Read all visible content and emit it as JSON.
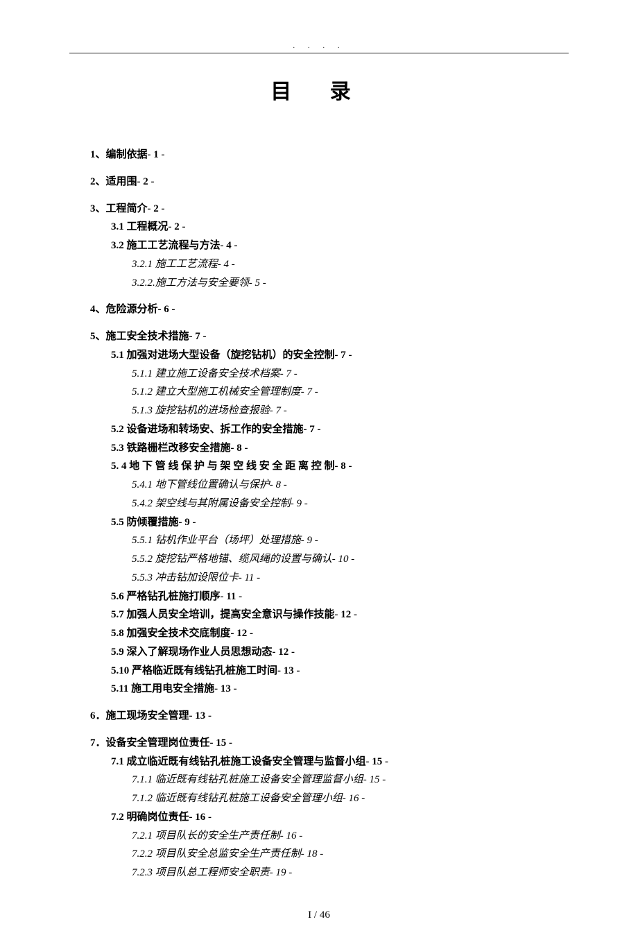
{
  "title": "目  录",
  "footer": "I / 46",
  "toc": [
    {
      "level": 1,
      "text": "1、编制依据- 1 -"
    },
    {
      "level": 1,
      "text": "2、适用围- 2 -"
    },
    {
      "level": 1,
      "text": "3、工程简介- 2 -"
    },
    {
      "level": 2,
      "text": "3.1 工程概况- 2 -"
    },
    {
      "level": 2,
      "text": "3.2 施工工艺流程与方法- 4 -"
    },
    {
      "level": 3,
      "text": "3.2.1 施工工艺流程- 4 -"
    },
    {
      "level": 3,
      "text": "3.2.2.施工方法与安全要领- 5 -"
    },
    {
      "level": 1,
      "text": "4、危险源分析- 6 -"
    },
    {
      "level": 1,
      "text": "5、施工安全技术措施- 7 -"
    },
    {
      "level": 2,
      "text": "5.1 加强对进场大型设备（旋挖钻机）的安全控制- 7 -"
    },
    {
      "level": 3,
      "text": "5.1.1 建立施工设备安全技术档案- 7 -"
    },
    {
      "level": 3,
      "text": "5.1.2 建立大型施工机械安全管理制度- 7 -"
    },
    {
      "level": 3,
      "text": "5.1.3 旋挖钻机的进场检查报验- 7 -"
    },
    {
      "level": 2,
      "text": "5.2 设备进场和转场安、拆工作的安全措施- 7 -"
    },
    {
      "level": 2,
      "text": "5.3 铁路栅栏改移安全措施- 8 -"
    },
    {
      "level": 2,
      "text": "5. 4 地 下 管 线 保 护 与 架 空 线 安 全 距 离 控 制- 8 -"
    },
    {
      "level": 3,
      "text": "5.4.1 地下管线位置确认与保护- 8 -"
    },
    {
      "level": 3,
      "text": "5.4.2 架空线与其附属设备安全控制- 9 -"
    },
    {
      "level": 2,
      "text": "5.5 防倾覆措施- 9 -"
    },
    {
      "level": 3,
      "text": "5.5.1 钻机作业平台（场坪）处理措施- 9 -"
    },
    {
      "level": 3,
      "text": "5.5.2 旋挖钻严格地锚、缆风绳的设置与确认- 10 -"
    },
    {
      "level": 3,
      "text": "5.5.3 冲击钻加设限位卡- 11 -"
    },
    {
      "level": 2,
      "text": "5.6 严格钻孔桩施打顺序- 11 -"
    },
    {
      "level": 2,
      "text": "5.7 加强人员安全培训，提高安全意识与操作技能- 12 -"
    },
    {
      "level": 2,
      "text": "5.8 加强安全技术交底制度- 12 -"
    },
    {
      "level": 2,
      "text": "5.9 深入了解现场作业人员思想动态- 12 -"
    },
    {
      "level": 2,
      "text": "5.10 严格临近既有线钻孔桩施工时间- 13 -"
    },
    {
      "level": 2,
      "text": "5.11 施工用电安全措施- 13 -"
    },
    {
      "level": 1,
      "text": "6．施工现场安全管理- 13 -"
    },
    {
      "level": 1,
      "text": "7．设备安全管理岗位责任- 15 -"
    },
    {
      "level": 2,
      "text": "7.1 成立临近既有线钻孔桩施工设备安全管理与监督小组- 15 -"
    },
    {
      "level": 3,
      "text": "7.1.1 临近既有线钻孔桩施工设备安全管理监督小组- 15 -"
    },
    {
      "level": 3,
      "text": "7.1.2 临近既有线钻孔桩施工设备安全管理小组- 16 -"
    },
    {
      "level": 2,
      "text": "7.2 明确岗位责任- 16 -"
    },
    {
      "level": 3,
      "text": "7.2.1 项目队长的安全生产责任制- 16 -"
    },
    {
      "level": 3,
      "text": "7.2.2 项目队安全总监安全生产责任制- 18 -"
    },
    {
      "level": 3,
      "text": "7.2.3 项目队总工程师安全职责- 19 -"
    }
  ]
}
